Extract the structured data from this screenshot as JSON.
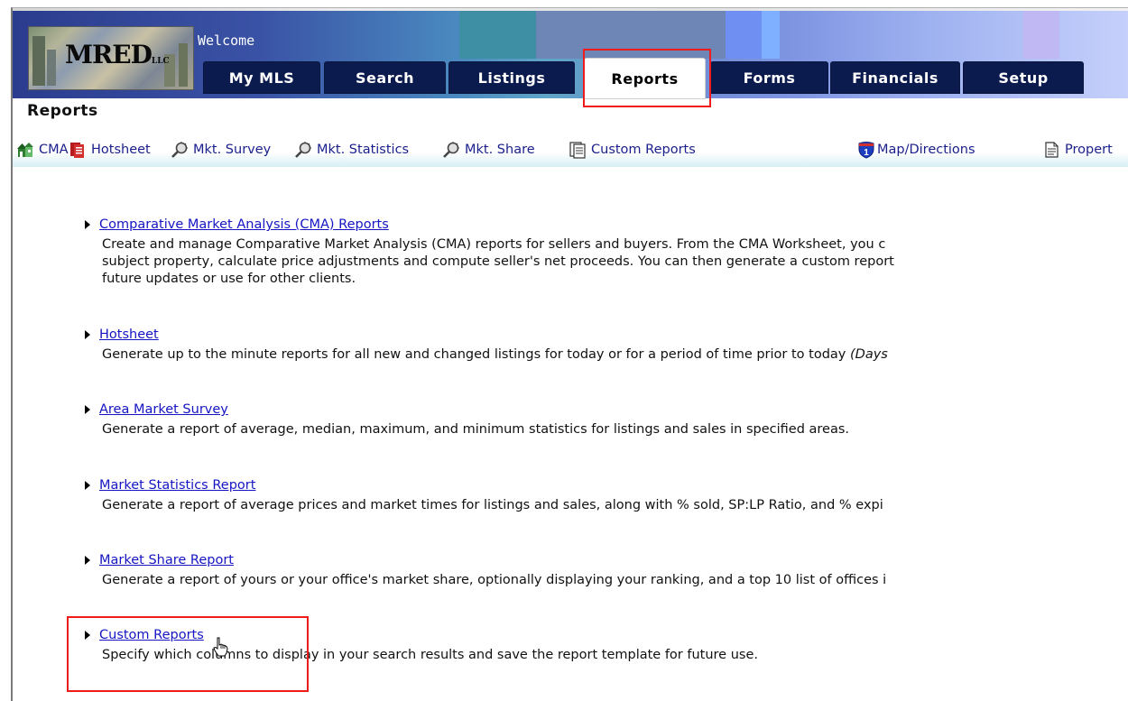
{
  "header": {
    "logo_text": "MRED",
    "logo_suffix": "LLC",
    "welcome": "Welcome",
    "tabs": [
      {
        "label": "My MLS"
      },
      {
        "label": "Search"
      },
      {
        "label": "Listings"
      },
      {
        "label": "Reports",
        "active": true
      },
      {
        "label": "Forms"
      },
      {
        "label": "Financials"
      },
      {
        "label": "Setup"
      }
    ]
  },
  "page_title": "Reports",
  "subnav": [
    {
      "label": "CMA",
      "icon": "house-icon"
    },
    {
      "label": "Hotsheet",
      "icon": "hotsheet-icon"
    },
    {
      "label": "Mkt. Survey",
      "icon": "magnifier-icon"
    },
    {
      "label": "Mkt. Statistics",
      "icon": "magnifier-icon"
    },
    {
      "label": "Mkt. Share",
      "icon": "magnifier-icon"
    },
    {
      "label": "Custom Reports",
      "icon": "report-icon"
    },
    {
      "label": "Map/Directions",
      "icon": "interstate-shield-icon"
    },
    {
      "label": "Propert",
      "icon": "document-icon"
    }
  ],
  "reports": [
    {
      "title": "Comparative Market Analysis (CMA) Reports",
      "desc": [
        "Create and manage Comparative Market Analysis (CMA) reports for sellers and buyers. From the CMA Worksheet, you c",
        "subject property, calculate price adjustments and compute seller's net proceeds. You can then generate a custom report",
        "future updates or use for other clients."
      ]
    },
    {
      "title": "Hotsheet",
      "desc_main": "Generate up to the minute reports for all new and changed listings for today or for a period of time prior to today ",
      "desc_italic": "(Days"
    },
    {
      "title": "Area Market Survey",
      "desc": [
        "Generate a report of average, median, maximum, and minimum statistics for listings and sales in specified areas."
      ]
    },
    {
      "title": "Market Statistics Report",
      "desc": [
        "Generate a report of average prices and market times for listings and sales, along with % sold, SP:LP Ratio, and % expi"
      ]
    },
    {
      "title": "Market Share Report",
      "desc": [
        "Generate a report of yours or your office's market share, optionally displaying your ranking, and a top 10 list of offices i"
      ]
    },
    {
      "title": "Custom Reports",
      "desc": [
        "Specify which columns to display in your search results and save the report template for future use."
      ]
    }
  ],
  "colors": {
    "tab_bg": "#0b1b4e",
    "link": "#1515c4",
    "subnav_link": "#1a1f8c",
    "highlight": "#ee1c1c"
  }
}
